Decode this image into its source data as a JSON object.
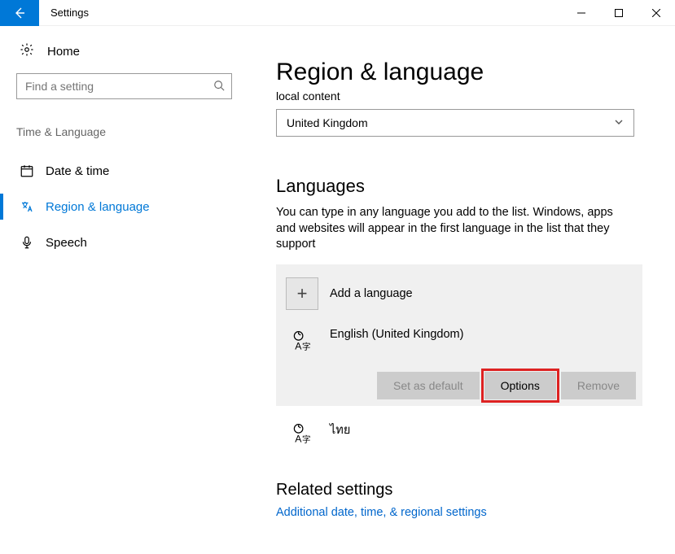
{
  "window": {
    "title": "Settings"
  },
  "sidebar": {
    "home": "Home",
    "search_placeholder": "Find a setting",
    "category": "Time & Language",
    "items": [
      {
        "label": "Date & time"
      },
      {
        "label": "Region & language"
      },
      {
        "label": "Speech"
      }
    ]
  },
  "main": {
    "title": "Region & language",
    "local_content_label": "local content",
    "local_content_value": "United Kingdom",
    "languages_title": "Languages",
    "languages_text": "You can type in any language you add to the list. Windows, apps and websites will appear in the first language in the list that they support",
    "add_language": "Add a language",
    "selected_language": "English (United Kingdom)",
    "buttons": {
      "set_default": "Set as default",
      "options": "Options",
      "remove": "Remove"
    },
    "extra_language": "ไทย",
    "related_title": "Related settings",
    "related_link": "Additional date, time, & regional settings"
  }
}
